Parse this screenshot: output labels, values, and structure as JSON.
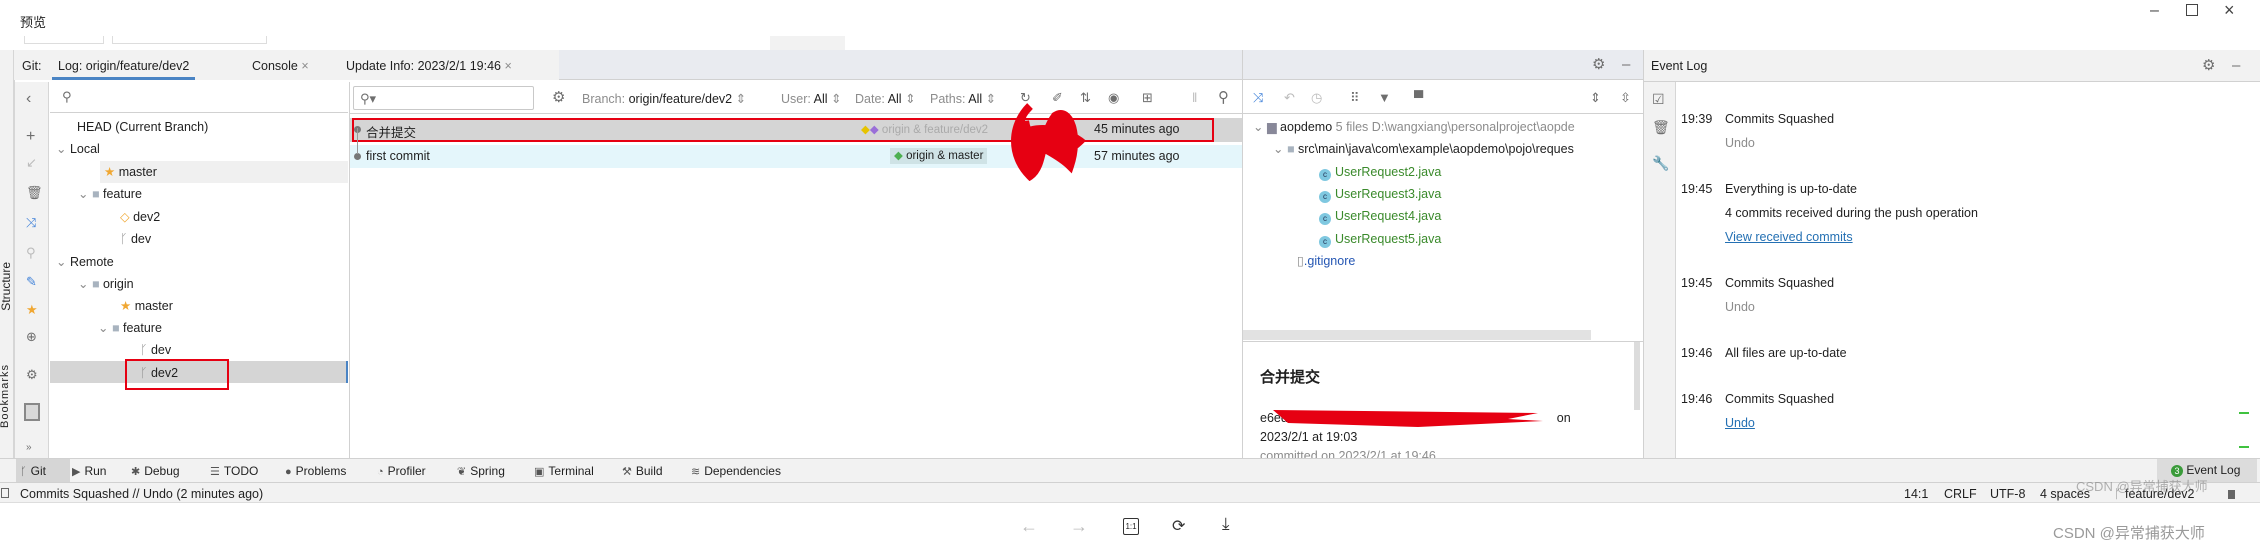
{
  "window": {
    "title": "预览"
  },
  "tabs": {
    "prefix": "Git:",
    "items": [
      {
        "label": "Log: origin/feature/dev2"
      },
      {
        "label": "Console"
      },
      {
        "label": "Update Info: 2023/2/1 19:46"
      }
    ],
    "close": "×"
  },
  "branches": {
    "search_placeholder": "",
    "head": "HEAD (Current Branch)",
    "local": "Local",
    "local_master": "master",
    "local_feature": "feature",
    "local_dev2": "dev2",
    "local_dev": "dev",
    "remote": "Remote",
    "origin": "origin",
    "remote_master": "master",
    "remote_feature": "feature",
    "remote_dev": "dev",
    "remote_dev2": "dev2"
  },
  "log": {
    "search_placeholder": "",
    "filters": {
      "branch_label": "Branch:",
      "branch_value": "origin/feature/dev2",
      "user_label": "User:",
      "user_value": "All",
      "date_label": "Date:",
      "date_value": "All",
      "paths_label": "Paths:",
      "paths_value": "All"
    },
    "commits": [
      {
        "message": "合并提交",
        "refs": "origin & feature/dev2",
        "time": "45 minutes ago"
      },
      {
        "message": "first commit",
        "refs": "origin & master",
        "time": "57 minutes ago"
      }
    ]
  },
  "details": {
    "root": "aopdemo",
    "root_count": "5 files",
    "root_path": "D:\\wangxiang\\personalproject\\aopde",
    "dir": "src\\main\\java\\com\\example\\aopdemo\\pojo\\reques",
    "files": [
      "UserRequest2.java",
      "UserRequest3.java",
      "UserRequest4.java",
      "UserRequest5.java"
    ],
    "other_file": ".gitignore",
    "commit_title": "合并提交",
    "hash_prefix": "e6ed6",
    "hash_suffix": "on",
    "author_date": "2023/2/1 at 19:03",
    "committed": "committed on 2023/2/1 at 19:46"
  },
  "event_log": {
    "title": "Event Log",
    "entries": [
      {
        "time": "19:39",
        "title": "Commits Squashed",
        "lines": [],
        "link": "Undo",
        "link_active": false
      },
      {
        "time": "19:45",
        "title": "Everything is up-to-date",
        "lines": [
          "4 commits received during the push operation"
        ],
        "link": "View received commits",
        "link_active": true
      },
      {
        "time": "19:45",
        "title": "Commits Squashed",
        "lines": [],
        "link": "Undo",
        "link_active": false
      },
      {
        "time": "19:46",
        "title": "All files are up-to-date",
        "lines": [],
        "link": "",
        "link_active": false
      },
      {
        "time": "19:46",
        "title": "Commits Squashed",
        "lines": [],
        "link": "Undo",
        "link_active": true
      }
    ]
  },
  "left_strip": {
    "structure": "Structure",
    "bookmarks": "Bookmarks"
  },
  "toolwindows": [
    {
      "label": "Git",
      "icon": "branch-icon"
    },
    {
      "label": "Run",
      "icon": "play-icon"
    },
    {
      "label": "Debug",
      "icon": "bug-icon"
    },
    {
      "label": "TODO",
      "icon": "list-icon"
    },
    {
      "label": "Problems",
      "icon": "problems-icon"
    },
    {
      "label": "Profiler",
      "icon": "profiler-icon"
    },
    {
      "label": "Spring",
      "icon": "spring-icon"
    },
    {
      "label": "Terminal",
      "icon": "terminal-icon"
    },
    {
      "label": "Build",
      "icon": "hammer-icon"
    },
    {
      "label": "Dependencies",
      "icon": "dependencies-icon"
    }
  ],
  "event_log_button": {
    "label": "Event Log",
    "badge": "3"
  },
  "status": {
    "message": "Commits Squashed // Undo (2 minutes ago)",
    "position": "14:1",
    "line_sep": "CRLF",
    "encoding": "UTF-8",
    "indent": "4 spaces",
    "branch": "feature/dev2"
  },
  "viewer": {
    "zoom_label": "1:1"
  },
  "watermark": "CSDN @异常捕获大师",
  "colors": {
    "selected_row": "#d5d5d5",
    "hover_row": "#e4f6fb",
    "annotation_red": "#e60012",
    "link": "#2470b3",
    "added_file": "#3a8a2b"
  }
}
